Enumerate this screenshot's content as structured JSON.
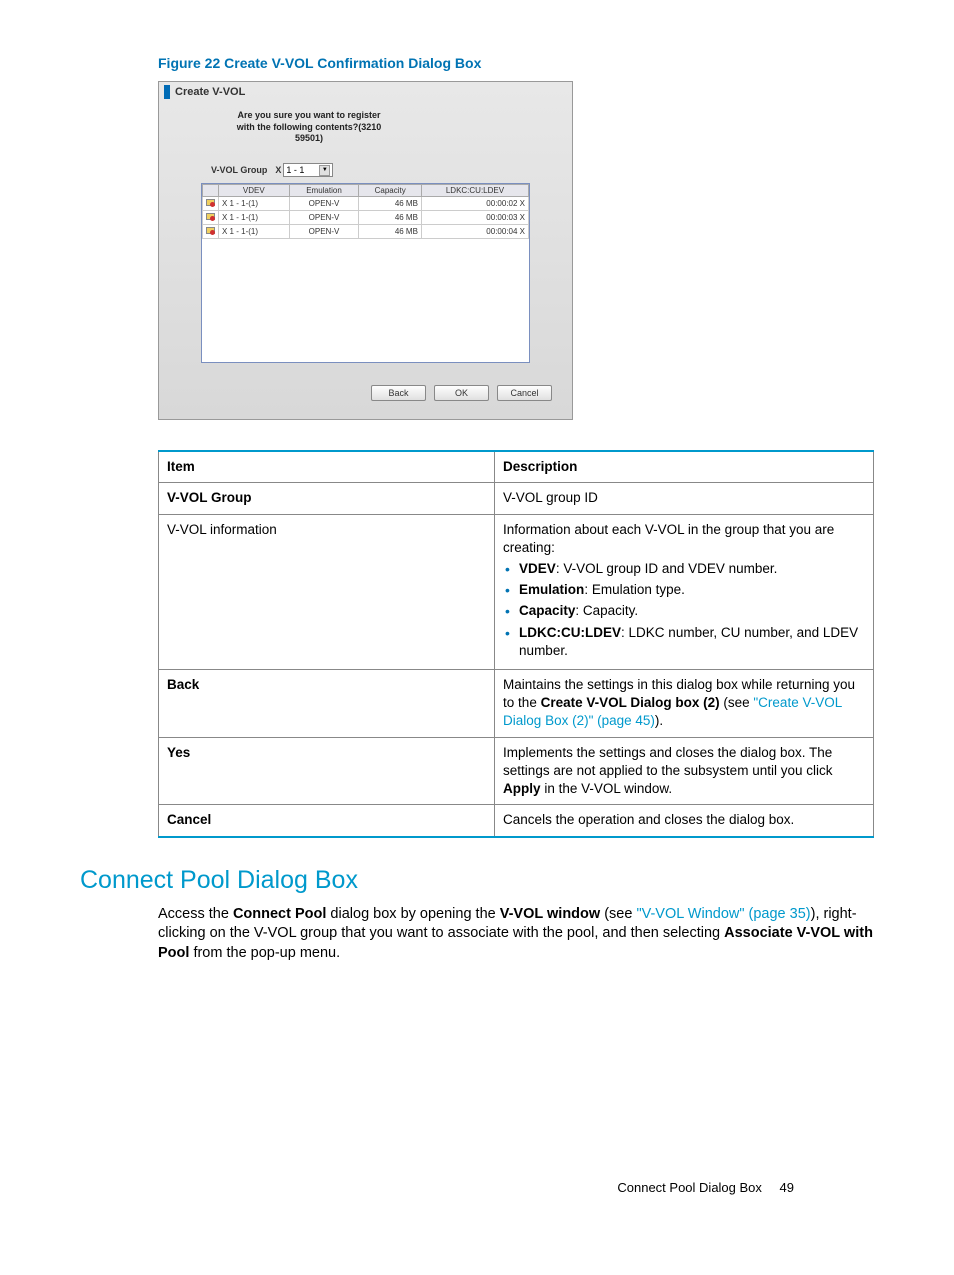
{
  "figure": {
    "caption": "Figure 22 Create V-VOL Confirmation Dialog Box"
  },
  "dialog": {
    "title": "Create V-VOL",
    "question_line1": "Are you sure you want to register",
    "question_line2": "with the following contents?(3210 59501)",
    "vvol_group_label": "V-VOL Group",
    "vvol_group_prefix": "X",
    "vvol_group_value": "1 - 1",
    "columns": {
      "vdev": "VDEV",
      "emulation": "Emulation",
      "capacity": "Capacity",
      "ldkc": "LDKC:CU:LDEV"
    },
    "rows": [
      {
        "vdev": "X 1 - 1-(1)",
        "emulation": "OPEN-V",
        "capacity": "46 MB",
        "ldkc": "00:00:02 X"
      },
      {
        "vdev": "X 1 - 1-(1)",
        "emulation": "OPEN-V",
        "capacity": "46 MB",
        "ldkc": "00:00:03 X"
      },
      {
        "vdev": "X 1 - 1-(1)",
        "emulation": "OPEN-V",
        "capacity": "46 MB",
        "ldkc": "00:00:04 X"
      }
    ],
    "buttons": {
      "back": "Back",
      "ok": "OK",
      "cancel": "Cancel"
    }
  },
  "desc_table": {
    "headers": {
      "item": "Item",
      "description": "Description"
    },
    "rows": {
      "vvol_group": {
        "item": "V-VOL Group",
        "desc": "V-VOL group ID"
      },
      "vvol_info": {
        "item": "V-VOL information",
        "intro": "Information about each V-VOL in the group that you are creating:",
        "bullets": {
          "vdev": {
            "bold": "VDEV",
            "text": ": V-VOL group ID and VDEV number."
          },
          "emulation": {
            "bold": "Emulation",
            "text": ": Emulation type."
          },
          "capacity": {
            "bold": "Capacity",
            "text": ": Capacity."
          },
          "ldkc": {
            "bold": "LDKC:CU:LDEV",
            "text": ": LDKC number, CU number, and LDEV number."
          }
        }
      },
      "back": {
        "item": "Back",
        "pre": "Maintains the settings in this dialog box while returning you to the ",
        "bold": "Create V-VOL Dialog box (2)",
        "mid": " (see ",
        "link": "\"Create V-VOL Dialog Box (2)\" (page 45)",
        "post": ")."
      },
      "yes": {
        "item": "Yes",
        "pre": "Implements the settings and closes the dialog box. The settings are not applied to the subsystem until you click ",
        "bold": "Apply",
        "post": " in the V-VOL window."
      },
      "cancel": {
        "item": "Cancel",
        "desc": "Cancels the operation and closes the dialog box."
      }
    }
  },
  "section": {
    "heading": "Connect Pool Dialog Box",
    "body": {
      "p1_pre": "Access the ",
      "p1_bold1": "Connect Pool",
      "p1_mid1": " dialog box by opening the ",
      "p1_bold2": "V-VOL window",
      "p1_mid2": " (see ",
      "p1_link": "\"V-VOL Window\" (page 35)",
      "p1_post1": "), right-clicking on the V-VOL group that you want to associate with the pool, and then selecting ",
      "p1_bold3": "Associate V-VOL with Pool",
      "p1_post2": " from the pop-up menu."
    }
  },
  "footer": {
    "text": "Connect Pool Dialog Box",
    "page": "49"
  }
}
